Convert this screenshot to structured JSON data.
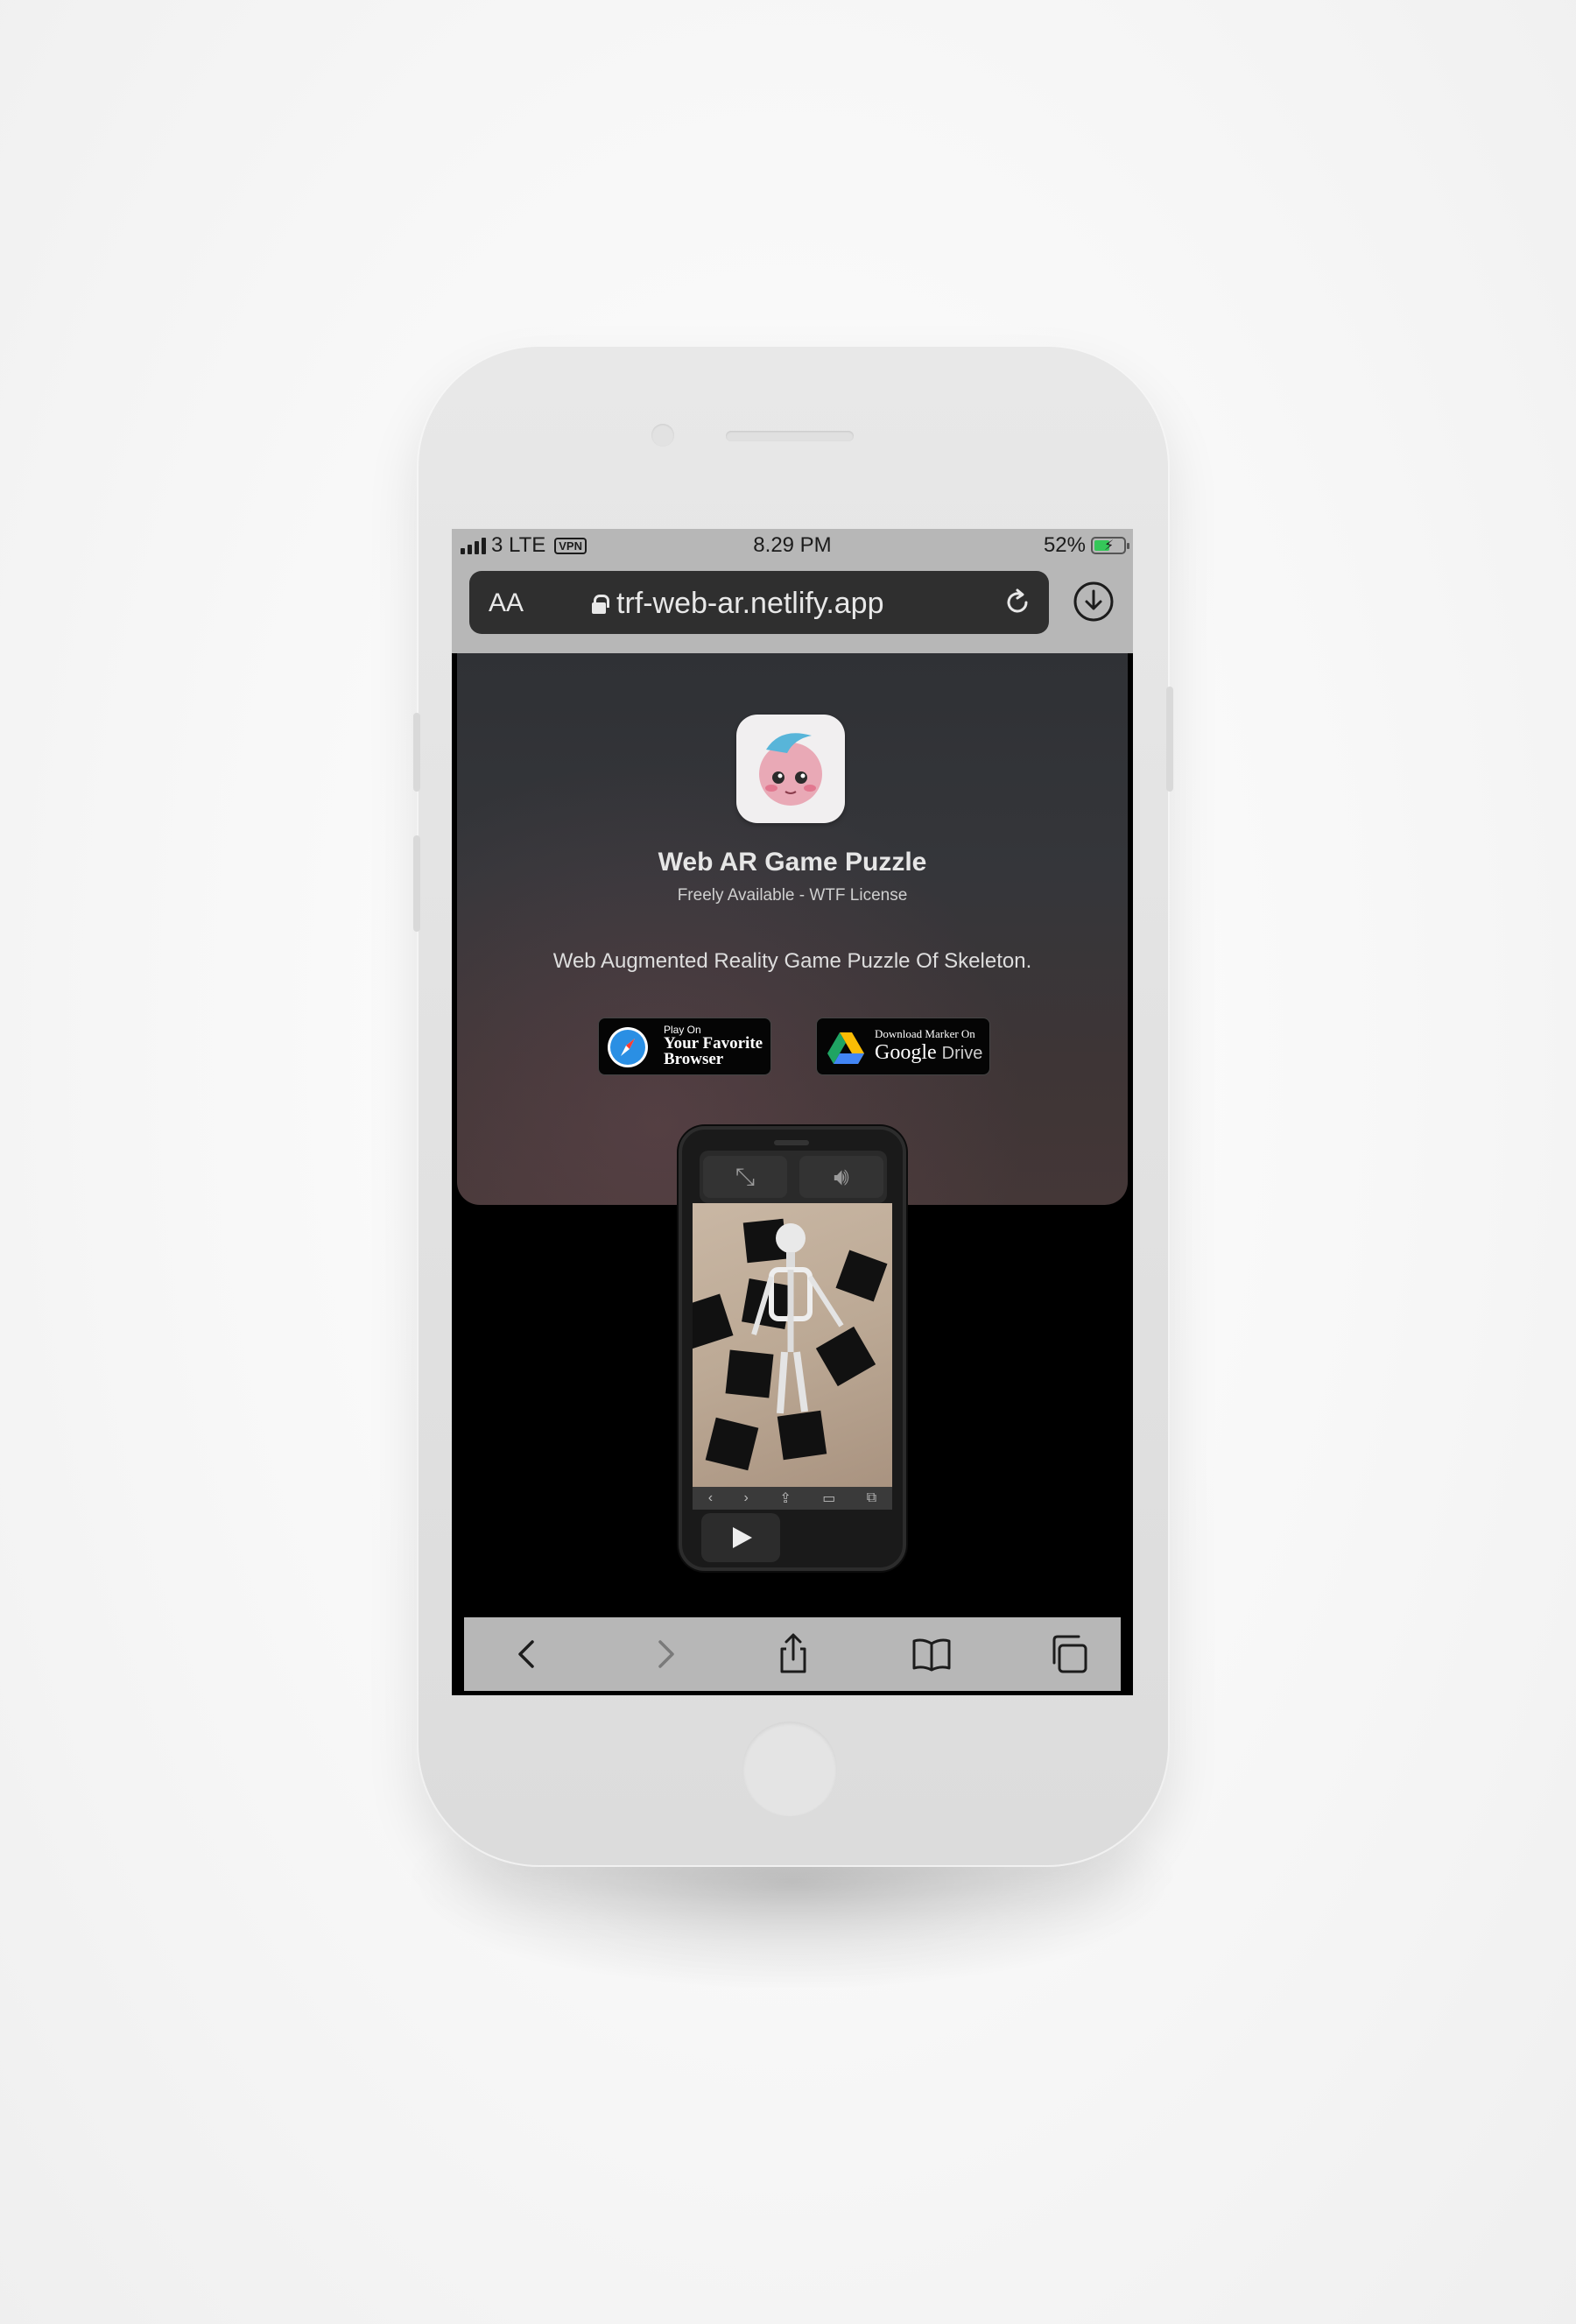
{
  "status_bar": {
    "carrier": "3 LTE",
    "vpn": "VPN",
    "time": "8.29 PM",
    "battery_percent": "52%",
    "battery_level": 0.52
  },
  "address_bar": {
    "text_size_label": "AA",
    "url": "trf-web-ar.netlify.app"
  },
  "hero": {
    "title": "Web AR Game Puzzle",
    "subtitle": "Freely Available - WTF License",
    "description": "Web Augmented Reality Game Puzzle Of Skeleton."
  },
  "badges": {
    "browser": {
      "line1": "Play On",
      "line2": "Your Favorite Browser"
    },
    "drive": {
      "line1": "Download Marker On",
      "brand": "Google",
      "product": "Drive"
    }
  },
  "icons": {
    "download": "download-circle-icon",
    "reload": "reload-icon",
    "lock": "lock-icon",
    "back": "chevron-left-icon",
    "forward": "chevron-right-icon",
    "share": "share-icon",
    "bookmarks": "book-icon",
    "tabs": "tabs-icon"
  },
  "colors": {
    "browser_chrome": "#b7b7b7",
    "url_bar": "#2f2f2f",
    "hero_bg": "#35363a",
    "battery_green": "#35c759"
  }
}
